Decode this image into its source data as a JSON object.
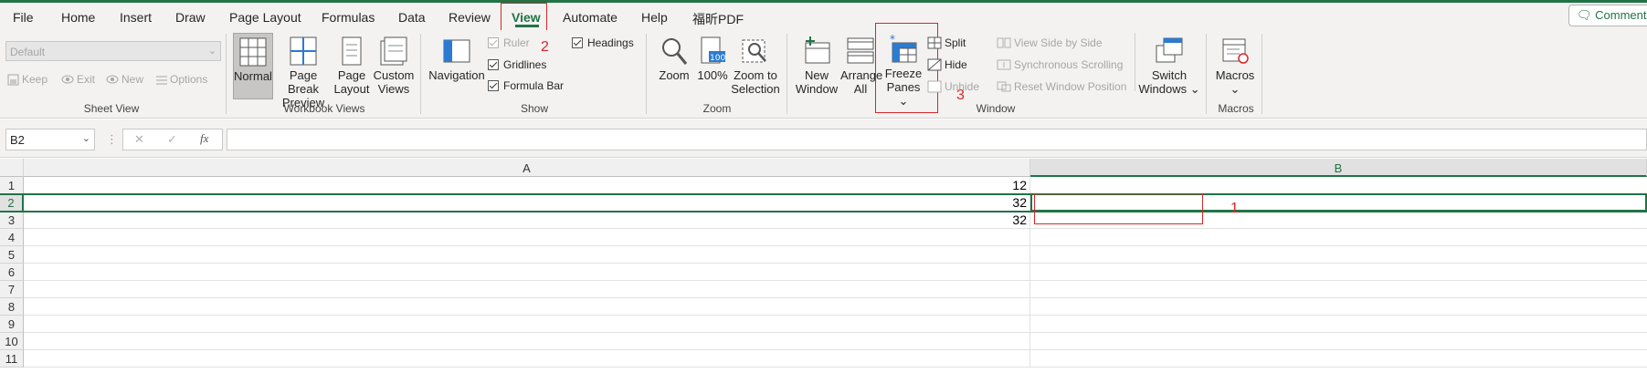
{
  "menu": {
    "tabs": [
      "File",
      "Home",
      "Insert",
      "Draw",
      "Page Layout",
      "Formulas",
      "Data",
      "Review",
      "View",
      "Automate",
      "Help",
      "福昕PDF"
    ],
    "active_tab": "View",
    "comments_label": "Comments"
  },
  "annotations": {
    "num1": "1",
    "num2": "2",
    "num3": "3"
  },
  "ribbon": {
    "sheet_view": {
      "dropdown_value": "Default",
      "keep": "Keep",
      "exit": "Exit",
      "new": "New",
      "options": "Options",
      "group_label": "Sheet View"
    },
    "workbook_views": {
      "normal": "Normal",
      "page_break_1": "Page Break",
      "page_break_2": "Preview",
      "page_layout_1": "Page",
      "page_layout_2": "Layout",
      "custom_1": "Custom",
      "custom_2": "Views",
      "group_label": "Workbook Views"
    },
    "show": {
      "navigation": "Navigation",
      "ruler": "Ruler",
      "gridlines": "Gridlines",
      "formula_bar": "Formula Bar",
      "headings": "Headings",
      "group_label": "Show"
    },
    "zoom": {
      "zoom": "Zoom",
      "zoom100": "100%",
      "zoom_sel_1": "Zoom to",
      "zoom_sel_2": "Selection",
      "group_label": "Zoom"
    },
    "window": {
      "new_window_1": "New",
      "new_window_2": "Window",
      "arrange_1": "Arrange",
      "arrange_2": "All",
      "freeze_1": "Freeze",
      "freeze_2": "Panes ⌄",
      "split": "Split",
      "hide": "Hide",
      "unhide": "Unhide",
      "side_by_side": "View Side by Side",
      "sync_scroll": "Synchronous Scrolling",
      "reset_pos": "Reset Window Position",
      "switch_1": "Switch",
      "switch_2": "Windows ⌄",
      "group_label": "Window"
    },
    "macros": {
      "macros": "Macros",
      "macros_arrow": "⌄",
      "group_label": "Macros"
    }
  },
  "formula_bar": {
    "name_box": "B2",
    "cancel": "✕",
    "enter": "✓",
    "fx": "fx",
    "formula": ""
  },
  "sheet": {
    "columns": [
      "A",
      "B"
    ],
    "rows": [
      "1",
      "2",
      "3",
      "4",
      "5",
      "6",
      "7",
      "8",
      "9",
      "10",
      "11"
    ],
    "colA": [
      "12",
      "32",
      "32",
      "",
      "",
      "",
      "",
      "",
      "",
      "",
      ""
    ]
  },
  "colors": {
    "accent": "#217346",
    "annotation": "#d62728"
  }
}
